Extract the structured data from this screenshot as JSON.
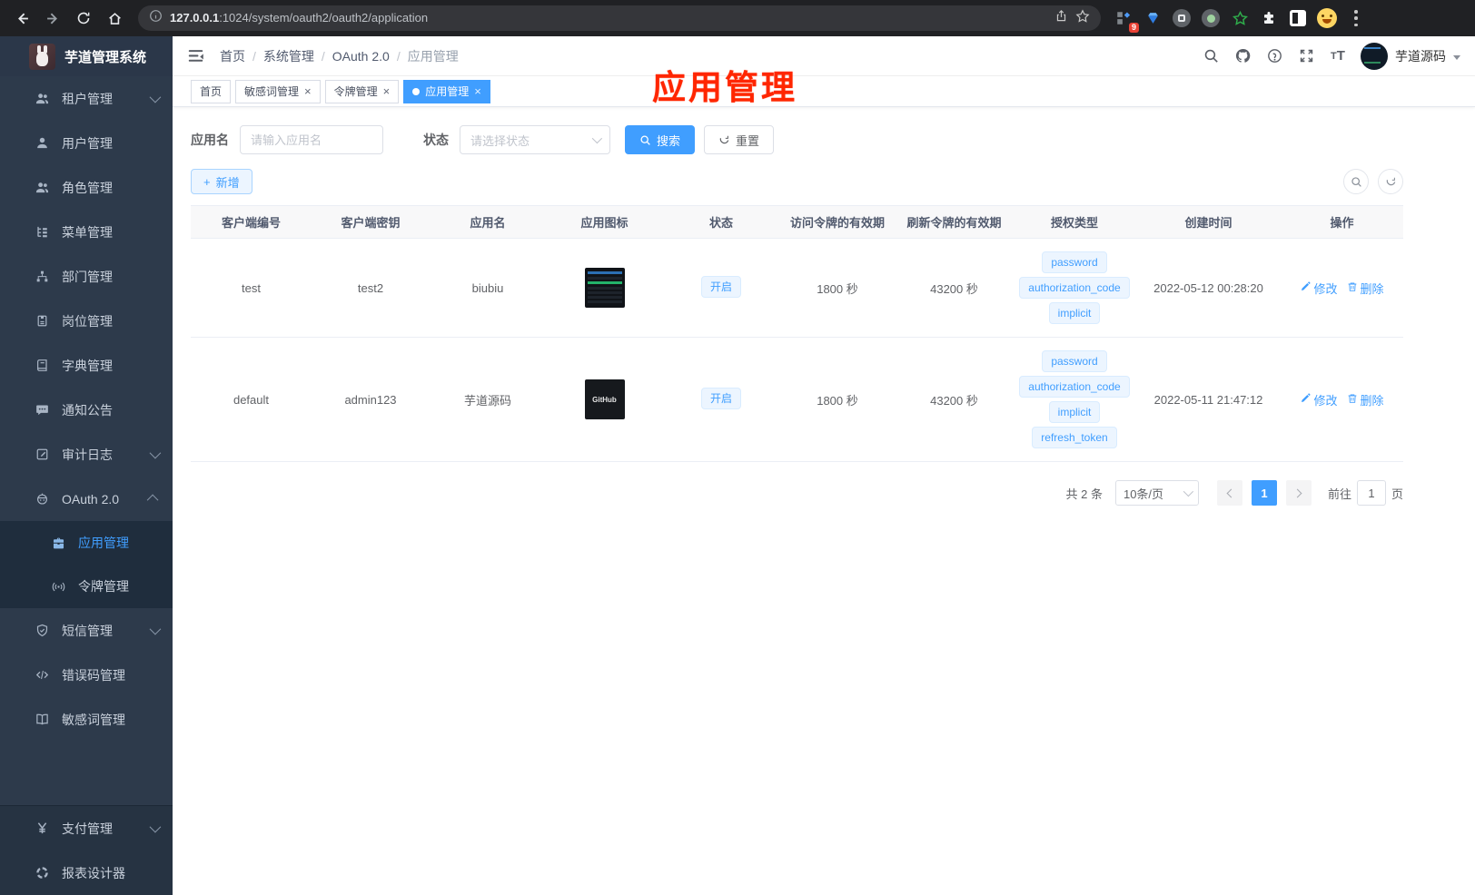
{
  "browser": {
    "host": "127.0.0.1",
    "path": ":1024/system/oauth2/oauth2/application",
    "extension_badge": "9"
  },
  "sidebar": {
    "title": "芋道管理系统",
    "items": [
      {
        "id": "tenant",
        "label": "租户管理",
        "icon": "users",
        "arrow": "down"
      },
      {
        "id": "user",
        "label": "用户管理",
        "icon": "user"
      },
      {
        "id": "role",
        "label": "角色管理",
        "icon": "users"
      },
      {
        "id": "menu",
        "label": "菜单管理",
        "icon": "menu-tree"
      },
      {
        "id": "dept",
        "label": "部门管理",
        "icon": "org-tree"
      },
      {
        "id": "post",
        "label": "岗位管理",
        "icon": "badge"
      },
      {
        "id": "dict",
        "label": "字典管理",
        "icon": "dictionary"
      },
      {
        "id": "notice",
        "label": "通知公告",
        "icon": "message"
      },
      {
        "id": "audit",
        "label": "审计日志",
        "icon": "audit",
        "arrow": "down"
      },
      {
        "id": "oauth2",
        "label": "OAuth 2.0",
        "icon": "robot",
        "arrow": "up",
        "children": [
          {
            "id": "oauth2-application",
            "label": "应用管理",
            "icon": "briefcase",
            "active": true
          },
          {
            "id": "oauth2-token",
            "label": "令牌管理",
            "icon": "broadcast"
          }
        ]
      },
      {
        "id": "sms",
        "label": "短信管理",
        "icon": "shield",
        "arrow": "down"
      },
      {
        "id": "errcode",
        "label": "错误码管理",
        "icon": "code"
      },
      {
        "id": "sensitive",
        "label": "敏感词管理",
        "icon": "open-book"
      },
      {
        "id": "pay",
        "label": "支付管理",
        "icon": "yen",
        "arrow": "down",
        "section": "bottom"
      },
      {
        "id": "report",
        "label": "报表设计器",
        "icon": "report",
        "section": "bottom"
      }
    ]
  },
  "header": {
    "breadcrumb": [
      "首页",
      "系统管理",
      "OAuth 2.0",
      "应用管理"
    ],
    "user_name": "芋道源码"
  },
  "annotation": "应用管理",
  "tabs": [
    {
      "label": "首页",
      "closable": false,
      "active": false
    },
    {
      "label": "敏感词管理",
      "closable": true,
      "active": false
    },
    {
      "label": "令牌管理",
      "closable": true,
      "active": false
    },
    {
      "label": "应用管理",
      "closable": true,
      "active": true
    }
  ],
  "filter": {
    "name_label": "应用名",
    "name_placeholder": "请输入应用名",
    "status_label": "状态",
    "status_placeholder": "请选择状态",
    "search": "搜索",
    "reset": "重置"
  },
  "toolbar": {
    "add": "新增"
  },
  "table": {
    "columns": [
      "客户端编号",
      "客户端密钥",
      "应用名",
      "应用图标",
      "状态",
      "访问令牌的有效期",
      "刷新令牌的有效期",
      "授权类型",
      "创建时间",
      "操作"
    ],
    "action_labels": [
      "修改",
      "删除"
    ],
    "rows": [
      {
        "client_id": "test",
        "secret": "test2",
        "name": "biubiu",
        "icon": "screenshot",
        "icon_label": "",
        "status": "开启",
        "access_validity": "1800 秒",
        "refresh_validity": "43200 秒",
        "grants": [
          "password",
          "authorization_code",
          "implicit"
        ],
        "created": "2022-05-12 00:28:20"
      },
      {
        "client_id": "default",
        "secret": "admin123",
        "name": "芋道源码",
        "icon": "github",
        "icon_label": "GitHub",
        "status": "开启",
        "access_validity": "1800 秒",
        "refresh_validity": "43200 秒",
        "grants": [
          "password",
          "authorization_code",
          "implicit",
          "refresh_token"
        ],
        "created": "2022-05-11 21:47:12"
      }
    ]
  },
  "pagination": {
    "total": "共 2 条",
    "page_size": "10条/页",
    "current_page": "1",
    "goto_prefix": "前往",
    "goto_value": "1",
    "goto_suffix": "页"
  }
}
